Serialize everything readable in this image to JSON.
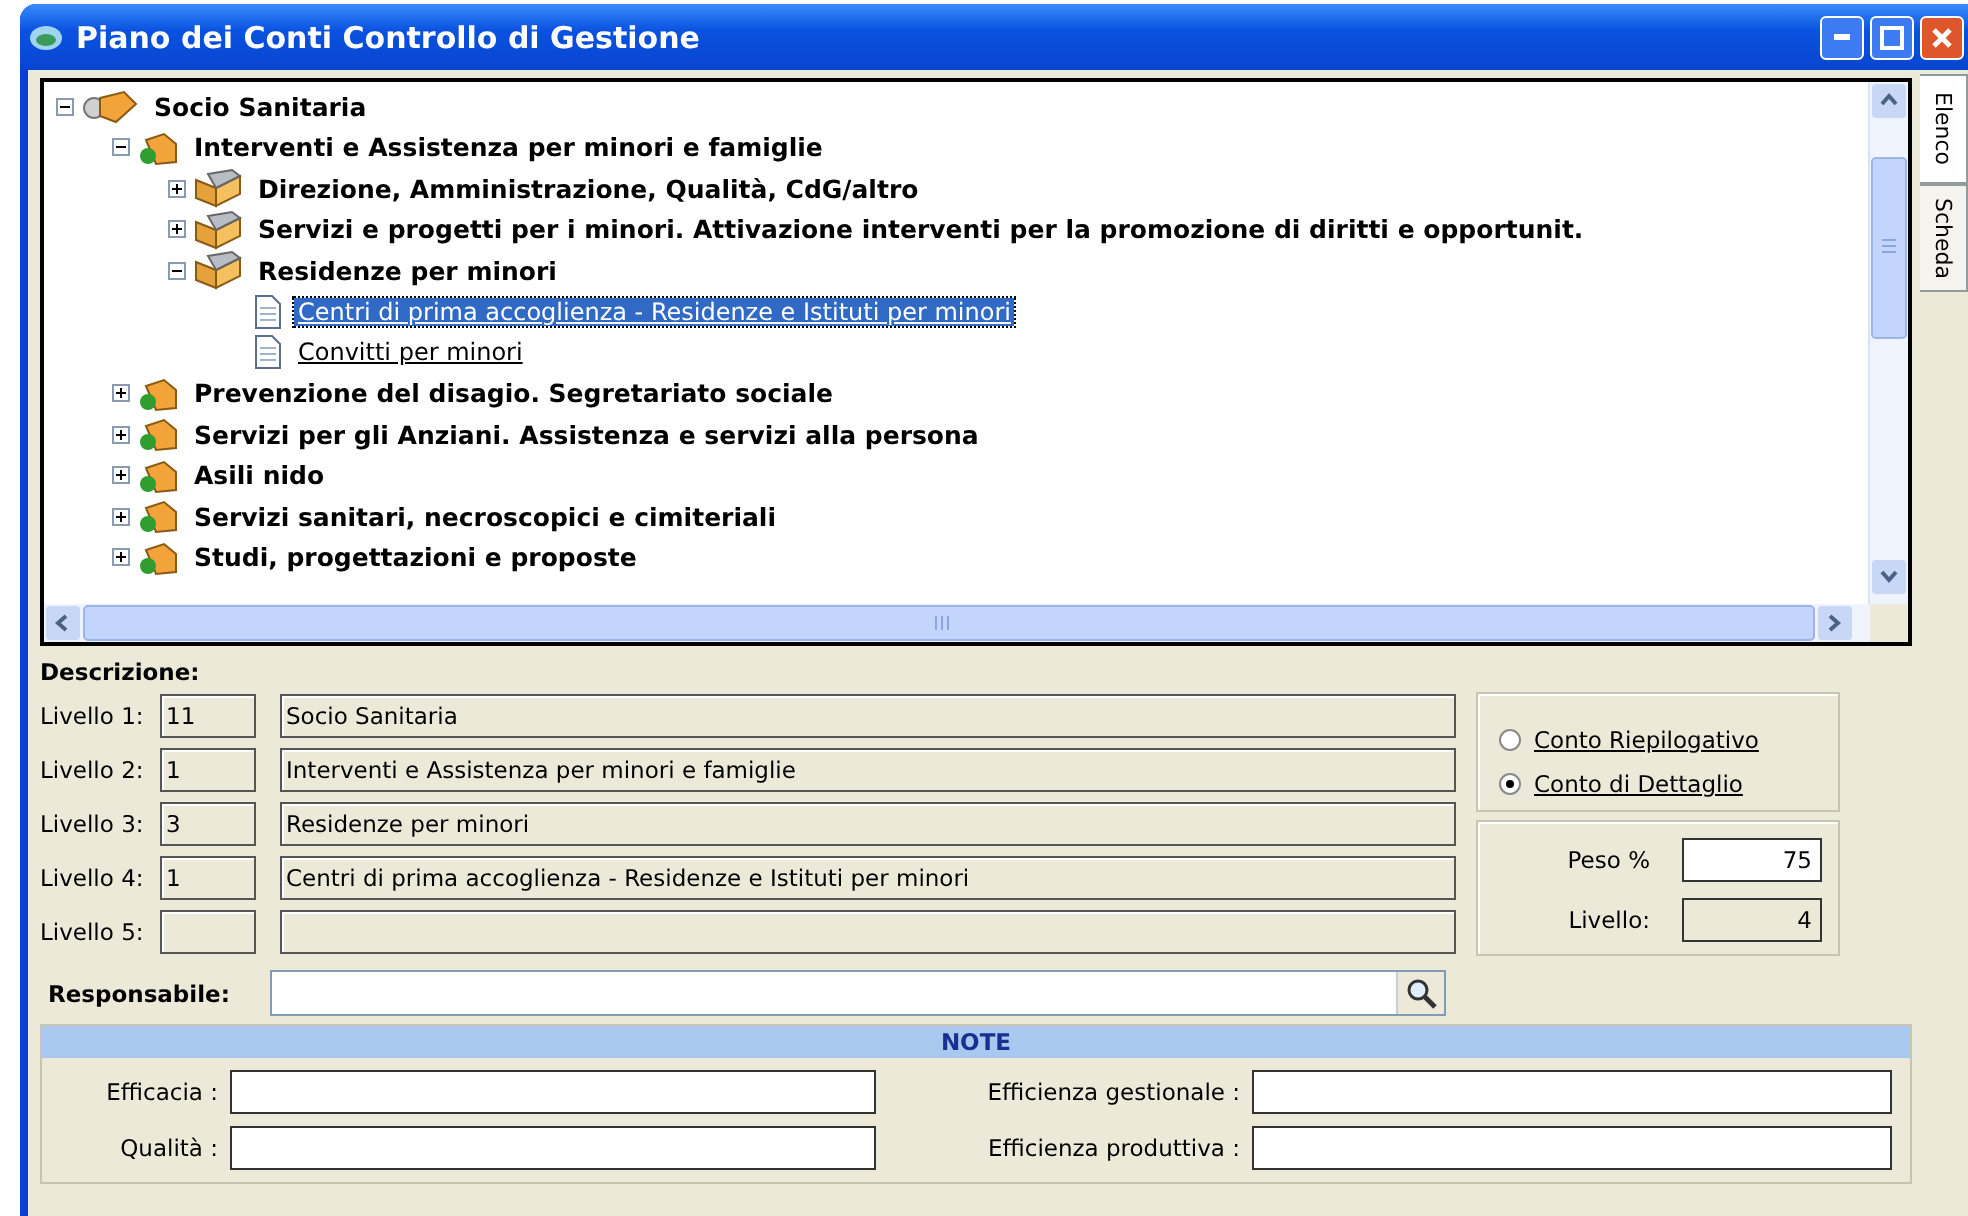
{
  "window": {
    "title": "Piano dei Conti Controllo di Gestione"
  },
  "side_tabs": [
    {
      "label": "Elenco",
      "selected": true
    },
    {
      "label": "Scheda",
      "selected": false
    }
  ],
  "tree": [
    {
      "label": "Socio Sanitaria",
      "expanded": true,
      "selected": false,
      "children": [
        {
          "label": "Interventi e Assistenza per minori e famiglie",
          "expanded": true,
          "selected": false,
          "children": [
            {
              "label": "Direzione, Amministrazione, Qualità, CdG/altro",
              "expanded": false,
              "selected": false
            },
            {
              "label": "Servizi e progetti per i minori. Attivazione interventi per la promozione di diritti e opportunit.",
              "expanded": false,
              "selected": false
            },
            {
              "label": "Residenze per minori",
              "expanded": true,
              "selected": false,
              "children": [
                {
                  "label": "Centri di prima accoglienza - Residenze e Istituti per minori",
                  "selected": true
                },
                {
                  "label": "Convitti per minori",
                  "selected": false
                }
              ]
            }
          ]
        },
        {
          "label": "Prevenzione del disagio. Segretariato sociale",
          "expanded": false,
          "selected": false
        },
        {
          "label": "Servizi per gli Anziani. Assistenza e servizi alla persona",
          "expanded": false,
          "selected": false
        },
        {
          "label": "Asili nido",
          "expanded": false,
          "selected": false
        },
        {
          "label": "Servizi sanitari, necroscopici e cimiteriali",
          "expanded": false,
          "selected": false
        },
        {
          "label": "Studi, progettazioni e proposte",
          "expanded": false,
          "selected": false
        }
      ]
    }
  ],
  "description_label": "Descrizione:",
  "levels": [
    {
      "label": "Livello 1:",
      "code": "11",
      "name": "Socio Sanitaria"
    },
    {
      "label": "Livello 2:",
      "code": "1",
      "name": "Interventi e Assistenza per minori e famiglie"
    },
    {
      "label": "Livello 3:",
      "code": "3",
      "name": "Residenze per minori"
    },
    {
      "label": "Livello 4:",
      "code": "1",
      "name": "Centri di prima accoglienza - Residenze e Istituti per minori"
    },
    {
      "label": "Livello 5:"
    }
  ],
  "account_type": [
    {
      "label": "Conto Riepilogativo",
      "selected": false
    },
    {
      "label": "Conto di Dettaglio",
      "selected": true
    }
  ],
  "peso": {
    "label": "Peso %",
    "value": "75"
  },
  "livello": {
    "label": "Livello:",
    "value": "4"
  },
  "responsabile": {
    "label": "Responsabile:"
  },
  "notes": {
    "title": "NOTE",
    "fields": [
      {
        "label": "Efficacia :"
      },
      {
        "label": "Efficienza gestionale :"
      },
      {
        "label": "Qualità :"
      },
      {
        "label": "Efficienza produttiva :"
      }
    ]
  }
}
